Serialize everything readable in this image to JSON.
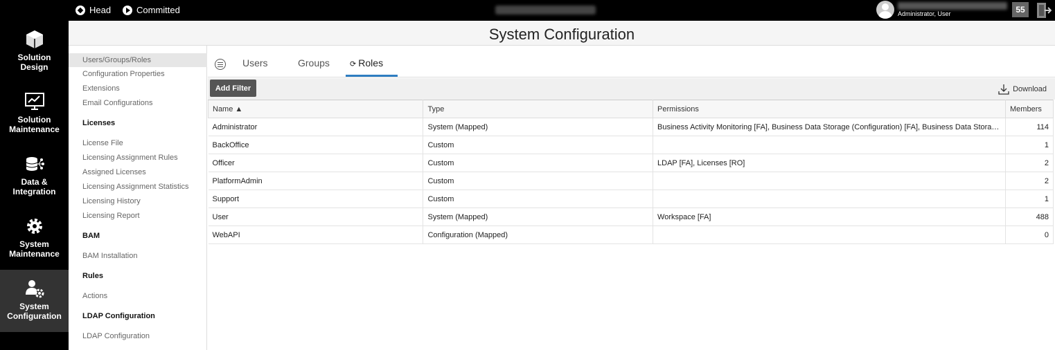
{
  "topbar": {
    "head_label": "Head",
    "committed_label": "Committed",
    "user_role": "Administrator, User",
    "notification_count": "55"
  },
  "leftnav": {
    "items": [
      {
        "label": "Solution\nDesign",
        "icon": "cube-icon"
      },
      {
        "label": "Solution\nMaintenance",
        "icon": "chart-monitor-icon"
      },
      {
        "label": "Data &\nIntegration",
        "icon": "database-network-icon"
      },
      {
        "label": "System\nMaintenance",
        "icon": "gear-icon"
      },
      {
        "label": "System\nConfiguration",
        "icon": "user-gear-icon"
      }
    ],
    "active_index": 4
  },
  "page": {
    "title": "System Configuration"
  },
  "sidebar": {
    "links": {
      "users_groups_roles": "Users/Groups/Roles",
      "configuration_properties": "Configuration Properties",
      "extensions": "Extensions",
      "email_configurations": "Email Configurations",
      "licenses_header": "Licenses",
      "license_file": "License File",
      "licensing_assignment_rules": "Licensing Assignment Rules",
      "assigned_licenses": "Assigned Licenses",
      "licensing_assignment_statistics": "Licensing Assignment Statistics",
      "licensing_history": "Licensing History",
      "licensing_report": "Licensing Report",
      "bam_header": "BAM",
      "bam_installation": "BAM Installation",
      "rules_header": "Rules",
      "actions": "Actions",
      "ldap_header": "LDAP Configuration",
      "ldap_configuration": "LDAP Configuration"
    }
  },
  "tabs": {
    "users": "Users",
    "groups": "Groups",
    "roles": "Roles",
    "active": "Roles"
  },
  "toolbar": {
    "add_filter": "Add Filter",
    "download": "Download"
  },
  "table": {
    "headers": {
      "name": "Name",
      "type": "Type",
      "permissions": "Permissions",
      "members": "Members"
    },
    "sort_indicator": "▲",
    "rows": [
      {
        "name": "Administrator",
        "type": "System (Mapped)",
        "permissions": "Business Activity Monitoring [FA], Business Data Storage (Configuration) [FA], Business Data Storage ...",
        "members": "114"
      },
      {
        "name": "BackOffice",
        "type": "Custom",
        "permissions": "",
        "members": "1"
      },
      {
        "name": "Officer",
        "type": "Custom",
        "permissions": "LDAP [FA], Licenses [RO]",
        "members": "2"
      },
      {
        "name": "PlatformAdmin",
        "type": "Custom",
        "permissions": "",
        "members": "2"
      },
      {
        "name": "Support",
        "type": "Custom",
        "permissions": "",
        "members": "1"
      },
      {
        "name": "User",
        "type": "System (Mapped)",
        "permissions": "Workspace [FA]",
        "members": "488"
      },
      {
        "name": "WebAPI",
        "type": "Configuration (Mapped)",
        "permissions": "",
        "members": "0"
      }
    ]
  },
  "colors": {
    "accent": "#2f7ec2",
    "nav_bg": "#000000",
    "nav_active": "#333333"
  }
}
